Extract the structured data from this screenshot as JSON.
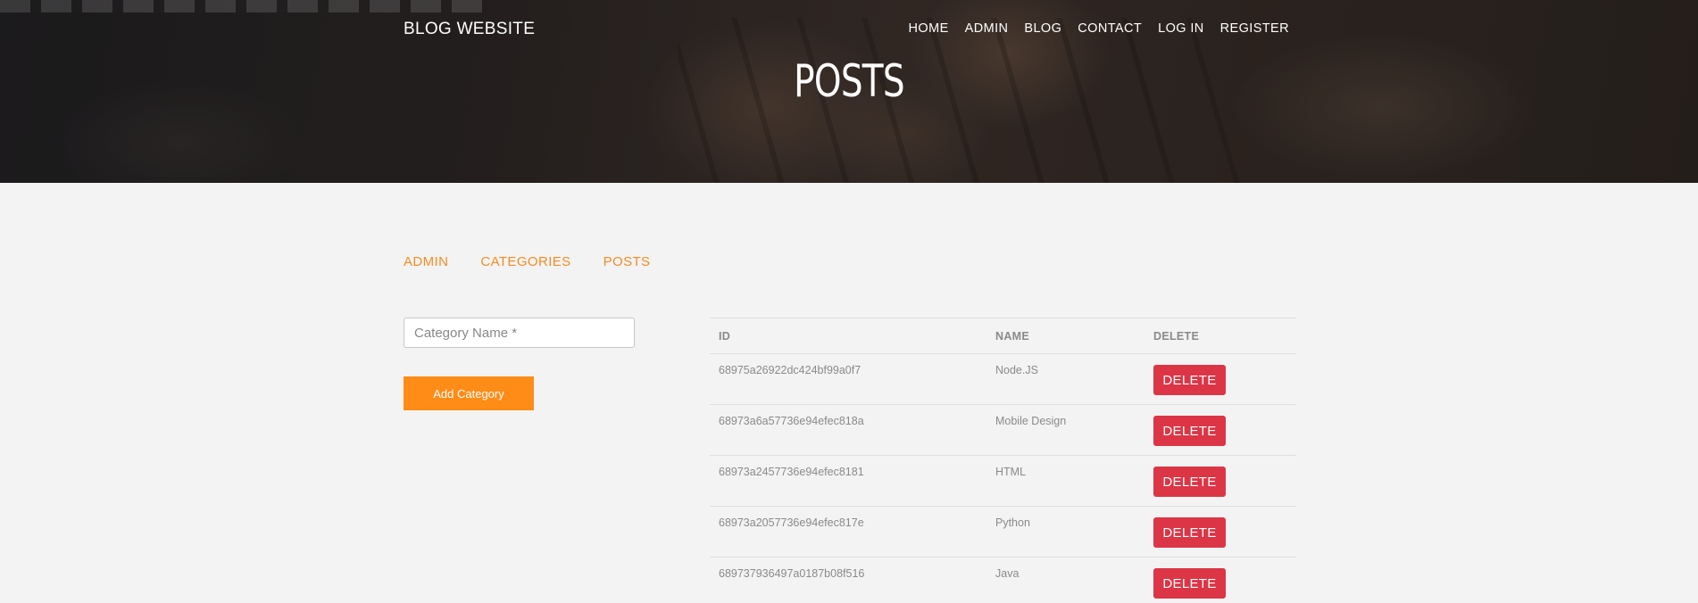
{
  "header": {
    "brand": "BLOG WEBSITE",
    "nav": [
      {
        "label": "HOME"
      },
      {
        "label": "ADMIN"
      },
      {
        "label": "BLOG"
      },
      {
        "label": "CONTACT"
      },
      {
        "label": "LOG IN"
      },
      {
        "label": "REGISTER"
      }
    ],
    "page_title": "POSTS"
  },
  "admin_nav": {
    "items": [
      {
        "label": "ADMIN"
      },
      {
        "label": "CATEGORIES"
      },
      {
        "label": "POSTS"
      }
    ]
  },
  "form": {
    "input_placeholder": "Category Name *",
    "input_value": "",
    "submit_label": "Add Category"
  },
  "table": {
    "columns": [
      "ID",
      "NAME",
      "DELETE"
    ],
    "delete_label": "DELETE",
    "rows": [
      {
        "id": "68975a26922dc424bf99a0f7",
        "name": "Node.JS"
      },
      {
        "id": "68973a6a57736e94efec818a",
        "name": "Mobile Design"
      },
      {
        "id": "68973a2457736e94efec8181",
        "name": "HTML"
      },
      {
        "id": "68973a2057736e94efec817e",
        "name": "Python"
      },
      {
        "id": "689737936497a0187b08f516",
        "name": "Java"
      }
    ]
  },
  "colors": {
    "accent": "#ff8c17",
    "link": "#f58c24",
    "danger": "#dc3545",
    "background": "#f3f3f3"
  }
}
